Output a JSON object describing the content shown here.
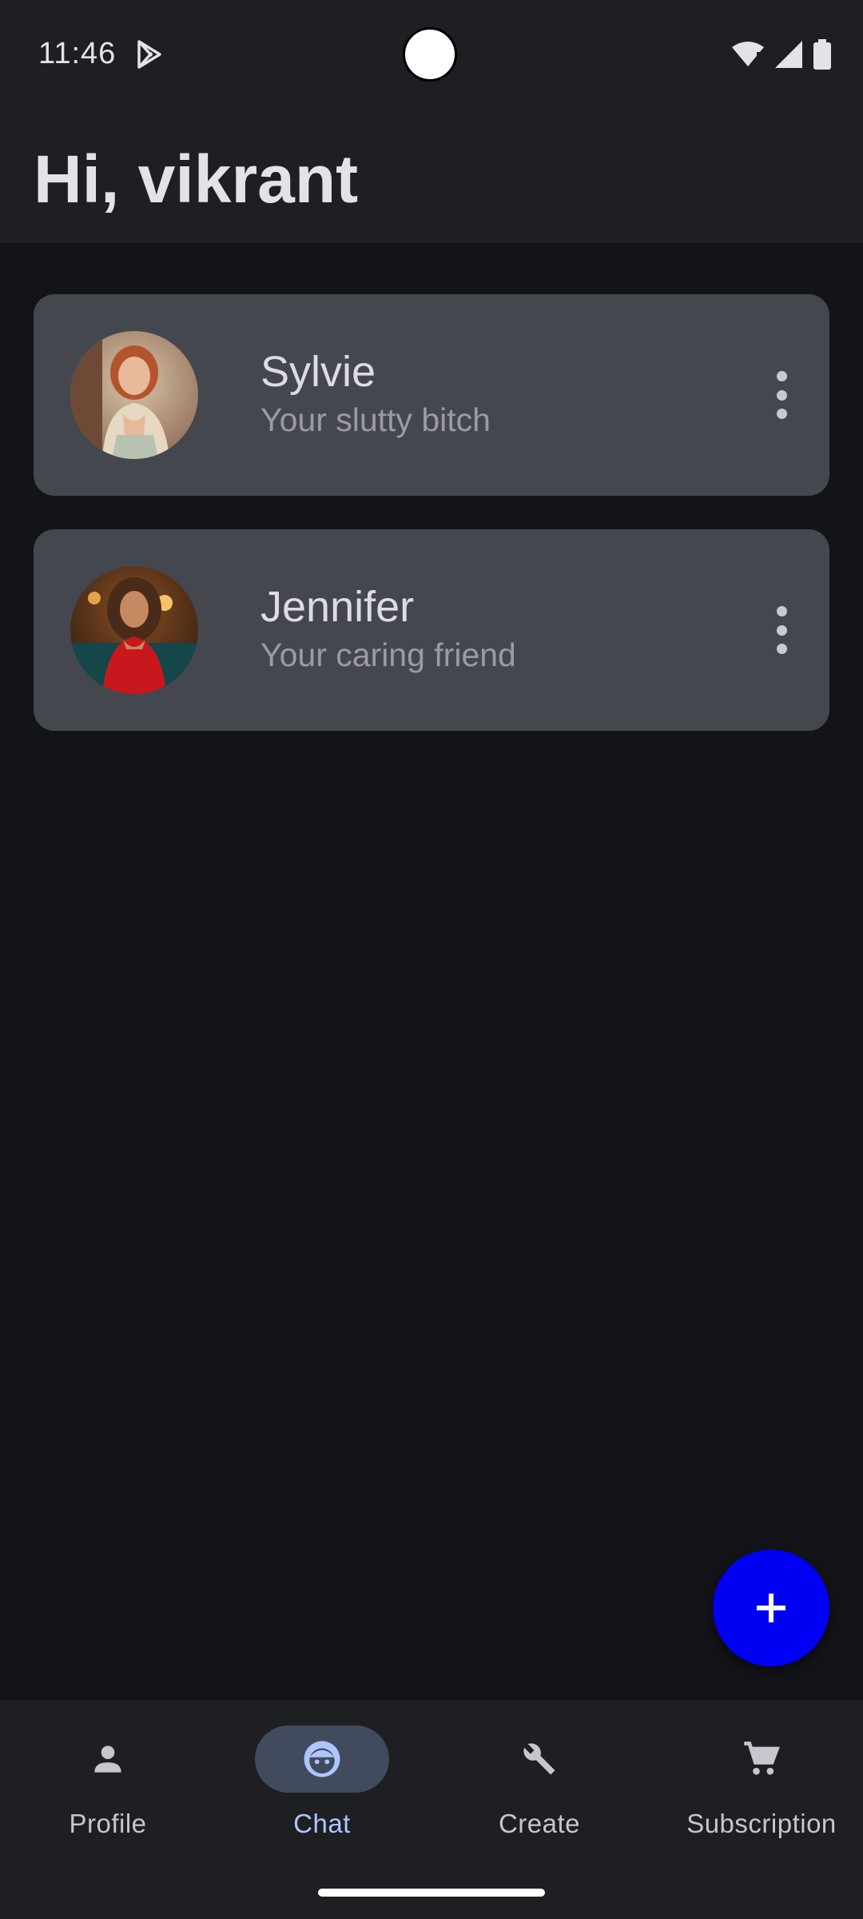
{
  "status": {
    "time": "11:46"
  },
  "header": {
    "greeting": "Hi, vikrant"
  },
  "characters": [
    {
      "name": "Sylvie",
      "description": "Your slutty bitch"
    },
    {
      "name": "Jennifer",
      "description": "Your caring friend"
    }
  ],
  "nav": {
    "items": [
      {
        "label": "Profile",
        "icon": "person-icon",
        "active": false
      },
      {
        "label": "Chat",
        "icon": "face-icon",
        "active": true
      },
      {
        "label": "Create",
        "icon": "wrench-icon",
        "active": false
      },
      {
        "label": "Subscription",
        "icon": "cart-icon",
        "active": false
      }
    ]
  },
  "colors": {
    "background": "#131418",
    "surface": "#1e1f23",
    "card": "#45474f",
    "fab": "#0000f5",
    "active_indicator": "#424a5e",
    "active_label": "#adc6ff"
  }
}
